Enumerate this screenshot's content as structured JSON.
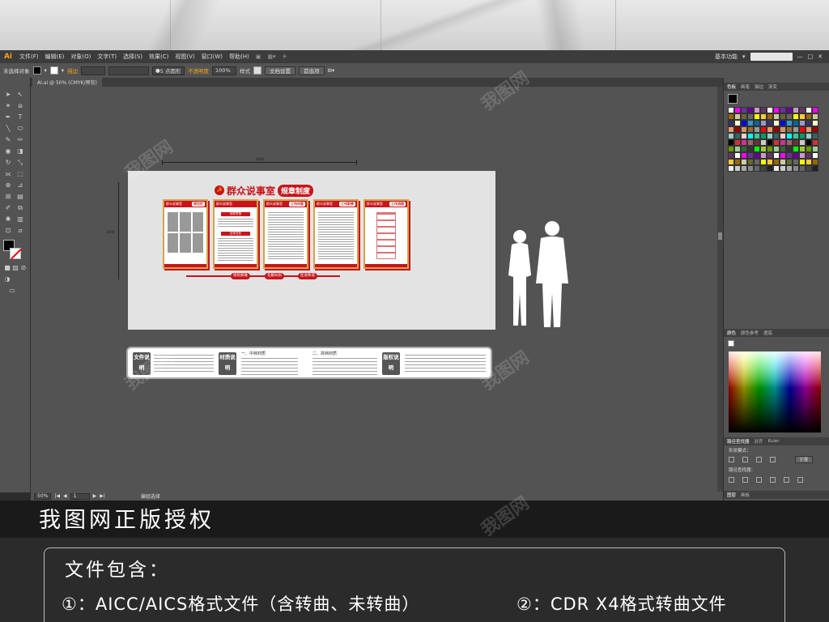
{
  "menubar": {
    "logo": "Ai",
    "items": [
      "文件(F)",
      "编辑(E)",
      "对象(O)",
      "文字(T)",
      "选择(S)",
      "效果(C)",
      "视图(V)",
      "窗口(W)",
      "帮助(H)"
    ],
    "workspace": "基本功能"
  },
  "control": {
    "selection": "未选择对象",
    "stroke_label": "描边",
    "brush": "5 点圆形",
    "opacity_label": "不透明度",
    "opacity_value": "100%",
    "style_label": "样式",
    "doc_settings": "文档设置",
    "prefs": "首选项"
  },
  "tab": {
    "title": "AI.ai @ 50% (CMYK/预览)"
  },
  "artboard": {
    "dim_width": "4600",
    "dim_height": "1600",
    "title_main": "群众说事室",
    "title_pill": "规章制度",
    "boards": [
      {
        "head": "群众说事室",
        "pill": "岗位栏"
      },
      {
        "head": "群众说事室",
        "pill": "指导思想",
        "sub2": "目标任务"
      },
      {
        "head": "群众说事室",
        "pill": "工作内容"
      },
      {
        "head": "群众说事室",
        "pill": "工作职责"
      },
      {
        "head": "群众说事室",
        "pill": "工作流程"
      }
    ],
    "slogans": [
      "排忧解难",
      "化解纠纷",
      "促进和谐"
    ]
  },
  "notes": {
    "label_file": "文件说明",
    "label_material": "材质说明",
    "label_copyright": "版权说明",
    "mid_material": "一、中档材质",
    "high_material": "二、高档材质"
  },
  "status": {
    "zoom": "50%",
    "page": "1",
    "mode": "编组选择"
  },
  "panels": {
    "tabs_top": [
      "色板",
      "画笔",
      "描边",
      "渐变"
    ],
    "tabs_color": [
      "颜色",
      "颜色参考",
      "透底"
    ],
    "tabs_path": [
      "路径查找器",
      "对齐",
      "Kuler"
    ],
    "shape_modes": "形状模式：",
    "expand": "扩展",
    "pathfinder": "路径查找器：",
    "tabs_layer": [
      "图层",
      "画板"
    ]
  },
  "promo": {
    "title": "我图网正版授权",
    "heading": "文件包含：",
    "line1": "①：AICC/AICS格式文件（含转曲、未转曲）",
    "line2": "②：CDR X4格式转曲文件"
  },
  "watermark": "我图网",
  "colors": {
    "party_red": "#c8141b",
    "gold": "#d4a44a",
    "ai_orange": "#f7a21b"
  }
}
